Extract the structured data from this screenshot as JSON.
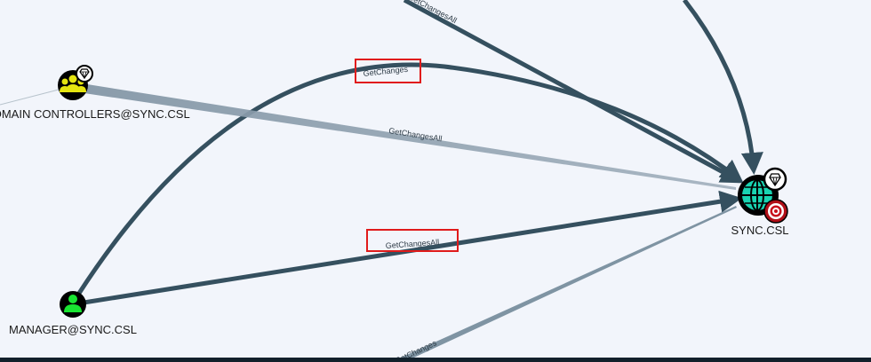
{
  "nodes": {
    "domain_controllers": {
      "label": "DOMAIN CONTROLLERS@SYNC.CSL",
      "icon": "group-icon",
      "badge": "gem-icon",
      "color": "#e5e510"
    },
    "sync": {
      "label": "SYNC.CSL",
      "icon": "globe-icon",
      "badge": "gem-icon",
      "target_badge": "target-icon",
      "color": "#19d4b2"
    },
    "manager": {
      "label": "MANAGER@SYNC.CSL",
      "icon": "user-icon",
      "color": "#19e632"
    }
  },
  "edges": {
    "top_partial": {
      "label": "GetChangesAll"
    },
    "getchanges_curve": {
      "label": "GetChanges",
      "highlighted": true
    },
    "dc_getchangesall": {
      "label": "GetChangesAll"
    },
    "manager_getchangesall": {
      "label": "GetChangesAll",
      "highlighted": true
    },
    "bottom_getchanges": {
      "label": "GetChanges"
    }
  },
  "colors": {
    "background": "#f2f5fb",
    "edge": "#35505f",
    "edge_faded": "#7f94a3",
    "highlight_box": "#e01b1b"
  }
}
